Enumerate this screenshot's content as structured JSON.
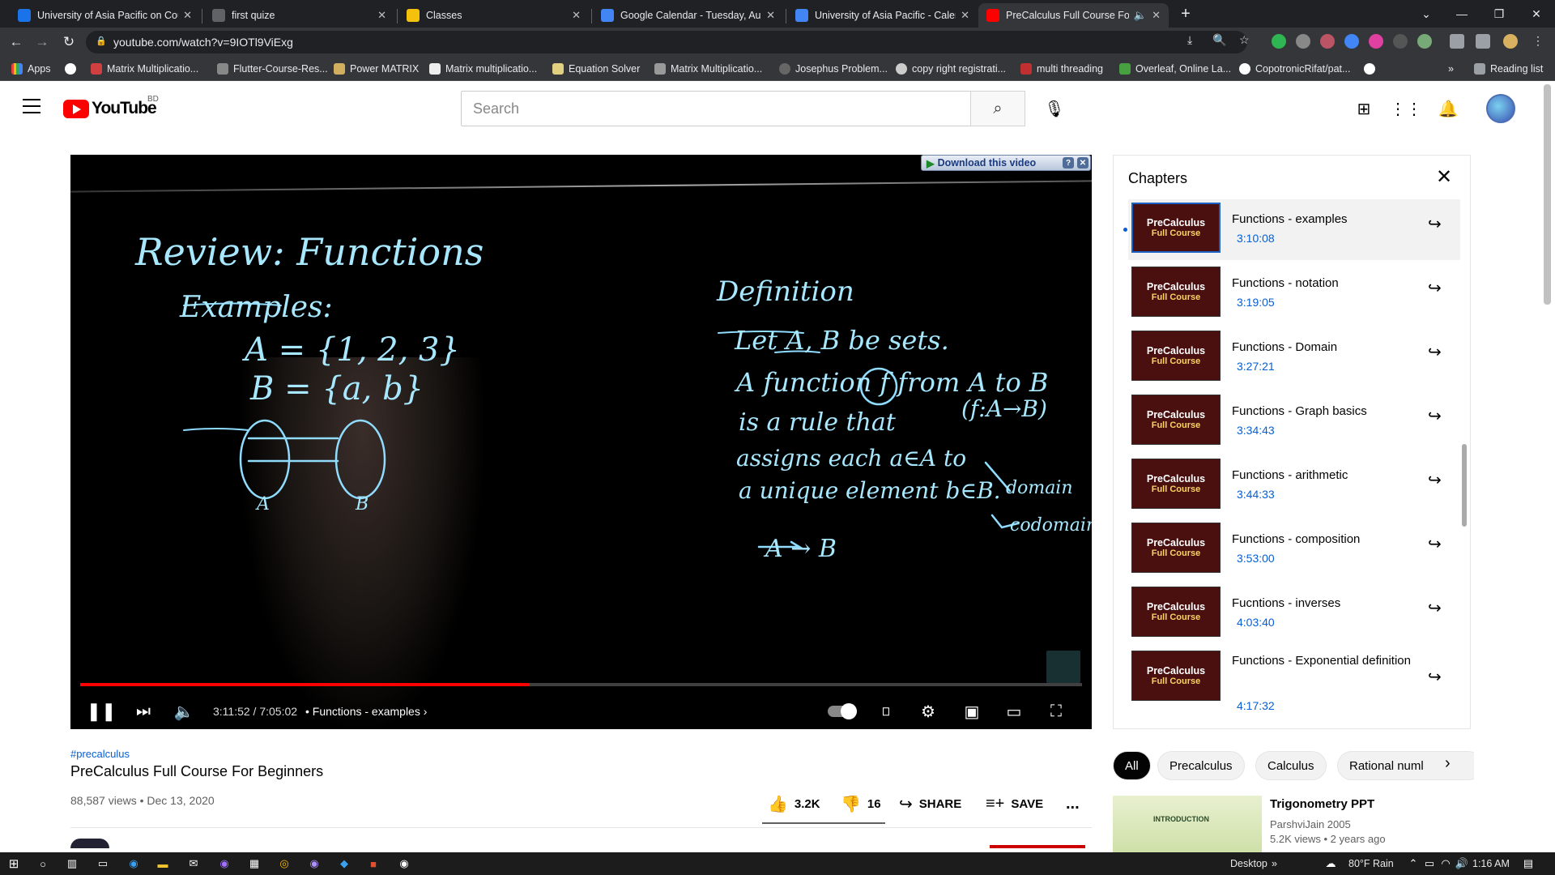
{
  "browser": {
    "tabs": [
      {
        "title": "University of Asia Pacific on Cour",
        "color": "#1a73e8"
      },
      {
        "title": "first quize",
        "color": "#5f6368"
      },
      {
        "title": "Classes",
        "color": "#f4c20d"
      },
      {
        "title": "Google Calendar - Tuesday, Augu",
        "color": "#4285f4"
      },
      {
        "title": "University of Asia Pacific - Calend",
        "color": "#4285f4"
      },
      {
        "title": "PreCalculus Full Course For B",
        "color": "#ff0000"
      }
    ],
    "url": "youtube.com/watch?v=9IOTl9ViExg",
    "bookmarks": [
      {
        "label": "Apps",
        "color": "#e8eaed"
      },
      {
        "label": "",
        "color": "#fff"
      },
      {
        "label": "Matrix Multiplicatio...",
        "color": "#d04040"
      },
      {
        "label": "Flutter-Course-Res...",
        "color": "#888"
      },
      {
        "label": "Power MATRIX",
        "color": "#d0b060"
      },
      {
        "label": "Matrix multiplicatio...",
        "color": "#eee"
      },
      {
        "label": "Equation Solver",
        "color": "#e0d080"
      },
      {
        "label": "Matrix Multiplicatio...",
        "color": "#999"
      },
      {
        "label": "Josephus Problem...",
        "color": "#666"
      },
      {
        "label": "copy right registrati...",
        "color": "#ccc"
      },
      {
        "label": "multi threading",
        "color": "#c03030"
      },
      {
        "label": "Overleaf, Online La...",
        "color": "#47a141"
      },
      {
        "label": "CopotronicRifat/pat...",
        "color": "#fff"
      },
      {
        "label": "",
        "color": "#fff"
      }
    ],
    "reading_list": "Reading list",
    "more_bookmarks": "»"
  },
  "youtube": {
    "logo_text": "YouTube",
    "country_code": "BD",
    "search_placeholder": "Search"
  },
  "player": {
    "download_label": "Download this video",
    "current_time": "3:11:52 / 7:05:02",
    "chapter_label": "• Functions - examples",
    "progress_fraction": 0.449
  },
  "video": {
    "hashtag": "#precalculus",
    "title": "PreCalculus Full Course For Beginners",
    "views": "88,587 views • Dec 13, 2020",
    "likes": "3.2K",
    "dislikes": "16",
    "share_label": "SHARE",
    "save_label": "SAVE",
    "more_label": "..."
  },
  "chapters": {
    "header": "Chapters",
    "thumb_line1": "PreCalculus",
    "thumb_line2": "Full Course",
    "items": [
      {
        "title": "Functions - examples",
        "time": "3:10:08"
      },
      {
        "title": "Functions - notation",
        "time": "3:19:05"
      },
      {
        "title": "Functions - Domain",
        "time": "3:27:21"
      },
      {
        "title": "Functions - Graph basics",
        "time": "3:34:43"
      },
      {
        "title": "Functions - arithmetic",
        "time": "3:44:33"
      },
      {
        "title": "Functions - composition",
        "time": "3:53:00"
      },
      {
        "title": "Fucntions - inverses",
        "time": "4:03:40"
      },
      {
        "title": "Functions - Exponential definition",
        "time": "4:17:32"
      }
    ]
  },
  "chips": [
    "All",
    "Precalculus",
    "Calculus",
    "Rational numl"
  ],
  "recommendation": {
    "title": "Trigonometry PPT",
    "channel": "ParshviJain 2005",
    "meta": "5.2K views • 2 years ago",
    "thumb_heading": "INTRODUCTION"
  },
  "taskbar": {
    "desktop_label": "Desktop",
    "more": "»",
    "weather": "80°F Rain",
    "clock": "1:16 AM"
  }
}
